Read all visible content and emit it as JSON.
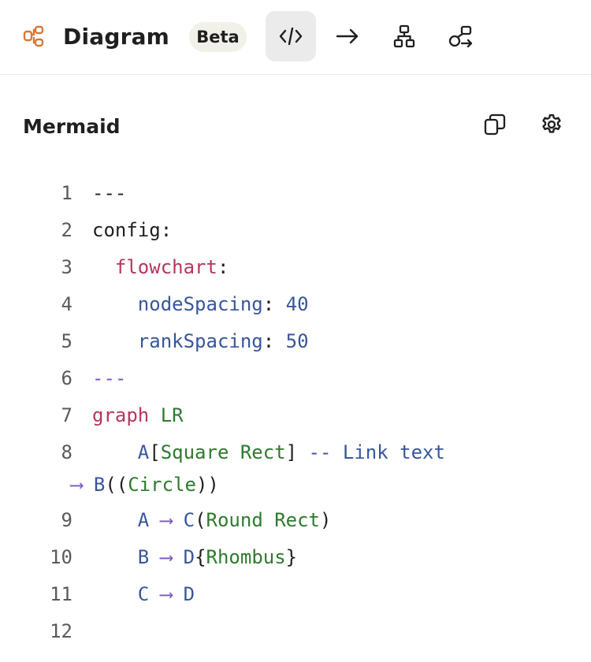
{
  "header": {
    "title": "Diagram",
    "badge": "Beta"
  },
  "section": {
    "title": "Mermaid"
  },
  "colors": {
    "keyword": "#b5375d",
    "identifier": "#38569b",
    "string": "#2f7a2f",
    "arrow": "#7a52c7",
    "logo": "#d9773a"
  },
  "icons": {
    "logo": "diagram-logo-icon",
    "toolbar": [
      "code-icon",
      "arrow-right-icon",
      "hierarchy-icon",
      "shapes-icon"
    ],
    "actions": [
      "copy-icon",
      "gear-icon"
    ]
  },
  "code": {
    "line_numbers": [
      "1",
      "2",
      "3",
      "4",
      "5",
      "6",
      "7",
      "8",
      "9",
      "10",
      "11",
      "12"
    ],
    "l1": "---",
    "l2_key": "config",
    "l2_punc": ":",
    "l3_key": "flowchart",
    "l3_punc": ":",
    "l4_key": "nodeSpacing",
    "l4_punc": ": ",
    "l4_val": "40",
    "l5_key": "rankSpacing",
    "l5_punc": ": ",
    "l5_val": "50",
    "l6": "---",
    "l7_kw": "graph",
    "l7_dir": "LR",
    "l8_a": "A",
    "l8_open": "[",
    "l8_label": "Square Rect",
    "l8_close": "]",
    "l8_link": " -- Link text",
    "l8_arrow": "⟶",
    "l8_b": "B",
    "l8_open2": "((",
    "l8_label2": "Circle",
    "l8_close2": "))",
    "l9_a": "A",
    "l9_arrow": "⟶",
    "l9_c": "C",
    "l9_open": "(",
    "l9_label": "Round Rect",
    "l9_close": ")",
    "l10_b": "B",
    "l10_arrow": "⟶",
    "l10_d": "D",
    "l10_open": "{",
    "l10_label": "Rhombus",
    "l10_close": "}",
    "l11_c": "C",
    "l11_arrow": "⟶",
    "l11_d": "D"
  }
}
